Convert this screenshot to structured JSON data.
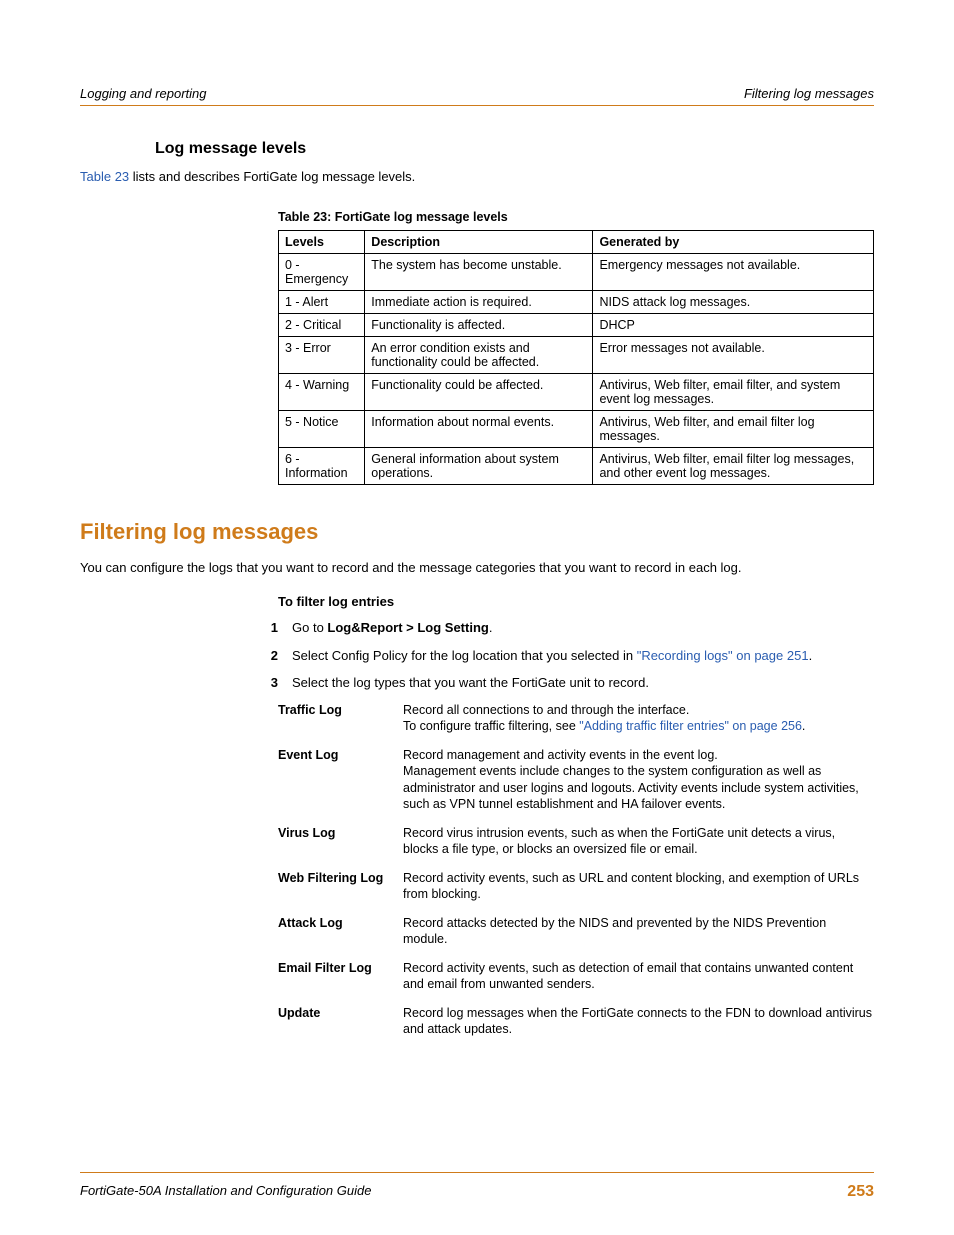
{
  "header": {
    "left": "Logging and reporting",
    "right": "Filtering log messages"
  },
  "footer": {
    "left": "FortiGate-50A Installation and Configuration Guide",
    "right": "253"
  },
  "section1": {
    "heading": "Log message levels",
    "intro_prefix": "Table 23",
    "intro_rest": " lists and describes FortiGate log message levels.",
    "table_caption": "Table 23: FortiGate log message levels",
    "columns": {
      "c0": "Levels",
      "c1": "Description",
      "c2": "Generated by"
    },
    "rows": [
      {
        "c0": "0 - Emergency",
        "c1": "The system has become unstable.",
        "c2": "Emergency messages not available."
      },
      {
        "c0": "1 - Alert",
        "c1": "Immediate action is required.",
        "c2": "NIDS attack log messages."
      },
      {
        "c0": "2 - Critical",
        "c1": "Functionality is affected.",
        "c2": "DHCP"
      },
      {
        "c0": "3 - Error",
        "c1": "An error condition exists and functionality could be affected.",
        "c2": "Error messages not available."
      },
      {
        "c0": "4 - Warning",
        "c1": "Functionality could be affected.",
        "c2": "Antivirus, Web filter, email filter, and system event log messages."
      },
      {
        "c0": "5 - Notice",
        "c1": "Information about normal events.",
        "c2": "Antivirus, Web filter, and email filter log messages."
      },
      {
        "c0": "6 - Information",
        "c1": "General information about system operations.",
        "c2": "Antivirus, Web filter, email filter log messages, and other event log messages."
      }
    ]
  },
  "section2": {
    "heading": "Filtering log messages",
    "intro": "You can configure the logs that you want to record and the message categories that you want to record in each log.",
    "proc_title": "To filter log entries",
    "steps": {
      "s1": {
        "num": "1",
        "pre": "Go to ",
        "bold": "Log&Report > Log Setting",
        "post": "."
      },
      "s2": {
        "num": "2",
        "pre": "Select Config Policy for the log location that you selected in ",
        "link": "\"Recording logs\" on page 251",
        "post": "."
      },
      "s3": {
        "num": "3",
        "text": "Select the log types that you want the FortiGate unit to record."
      }
    },
    "defs": [
      {
        "term": "Traffic Log",
        "line1": "Record all connections to and through the interface.",
        "line2_pre": "To configure traffic filtering, see ",
        "line2_link": "\"Adding traffic filter entries\" on page 256",
        "line2_post": "."
      },
      {
        "term": "Event Log",
        "line1": "Record management and activity events in the event log.",
        "line2": "Management events include changes to the system configuration as well as administrator and user logins and logouts. Activity events include system activities, such as VPN tunnel establishment and HA failover events."
      },
      {
        "term": "Virus Log",
        "line1": "Record virus intrusion events, such as when the FortiGate unit detects a virus, blocks a file type, or blocks an oversized file or email."
      },
      {
        "term": "Web Filtering Log",
        "line1": "Record activity events, such as URL and content blocking, and exemption of URLs from blocking."
      },
      {
        "term": "Attack Log",
        "line1": "Record attacks detected by the NIDS and prevented by the NIDS Prevention module."
      },
      {
        "term": "Email Filter Log",
        "line1": "Record activity events, such as detection of email that contains unwanted content and email from unwanted senders."
      },
      {
        "term": "Update",
        "line1": "Record log messages when the FortiGate connects to the FDN to download antivirus and attack updates."
      }
    ]
  }
}
